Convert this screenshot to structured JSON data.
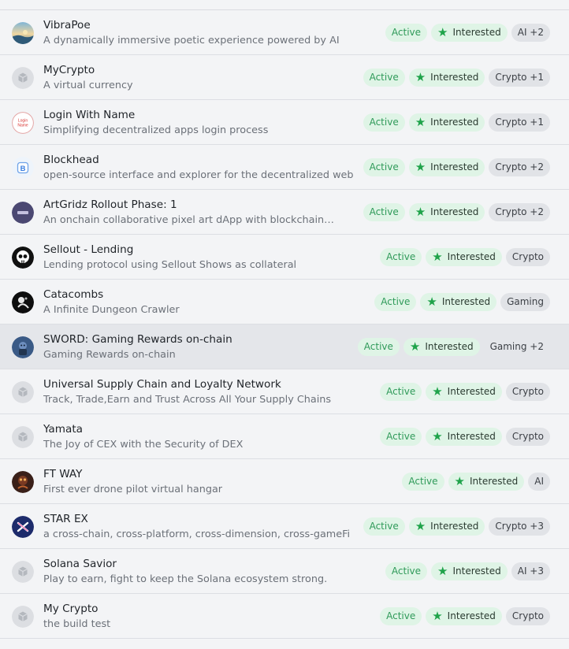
{
  "colors": {
    "active_bg": "#dff4e6",
    "active_text": "#2f9a59",
    "star": "#1fa34a",
    "category_bg": "#e1e3e7"
  },
  "rows": [
    {
      "name": "VibraPoe",
      "description": "A dynamically immersive poetic experience powered by AI",
      "status": "Active",
      "interest": "Interested",
      "category": "AI +2",
      "avatar_icon": "sunset-landscape-avatar-icon"
    },
    {
      "name": "MyCrypto",
      "description": "A virtual currency",
      "status": "Active",
      "interest": "Interested",
      "category": "Crypto +1",
      "avatar_icon": "placeholder-cube-icon"
    },
    {
      "name": "Login With Name",
      "description": "Simplifying decentralized apps login process",
      "status": "Active",
      "interest": "Interested",
      "category": "Crypto +1",
      "avatar_icon": "login-name-logo-icon",
      "avatar_text": "Login Name"
    },
    {
      "name": "Blockhead",
      "description": "open-source interface and explorer for the decentralized web",
      "status": "Active",
      "interest": "Interested",
      "category": "Crypto +2",
      "avatar_icon": "blockhead-b-logo-icon",
      "avatar_text": "B"
    },
    {
      "name": "ArtGridz Rollout Phase: 1",
      "description": "An onchain collaborative pixel art dApp with blockchain…",
      "status": "Active",
      "interest": "Interested",
      "category": "Crypto +2",
      "avatar_icon": "artgridz-logo-icon"
    },
    {
      "name": "Sellout - Lending",
      "description": "Lending protocol using Sellout Shows as collateral",
      "status": "Active",
      "interest": "Interested",
      "category": "Crypto",
      "avatar_icon": "skull-logo-icon"
    },
    {
      "name": "Catacombs",
      "description": "A Infinite Dungeon Crawler",
      "status": "Active",
      "interest": "Interested",
      "category": "Gaming",
      "avatar_icon": "catacombs-logo-icon"
    },
    {
      "name": "SWORD: Gaming Rewards on-chain",
      "description": "Gaming Rewards on-chain",
      "status": "Active",
      "interest": "Interested",
      "category": "Gaming +2",
      "avatar_icon": "sword-character-avatar-icon",
      "highlighted": true
    },
    {
      "name": "Universal Supply Chain and Loyalty Network",
      "description": "Track, Trade,Earn and Trust Across All Your Supply Chains",
      "status": "Active",
      "interest": "Interested",
      "category": "Crypto",
      "avatar_icon": "placeholder-cube-icon"
    },
    {
      "name": "Yamata",
      "description": "The Joy of CEX with the Security of DEX",
      "status": "Active",
      "interest": "Interested",
      "category": "Crypto",
      "avatar_icon": "placeholder-cube-icon"
    },
    {
      "name": "FT WAY",
      "description": "First ever drone pilot virtual hangar",
      "status": "Active",
      "interest": "Interested",
      "category": "AI",
      "avatar_icon": "ft-way-photo-avatar-icon"
    },
    {
      "name": "STAR EX",
      "description": "a cross-chain, cross-platform, cross-dimension, cross-gameFi",
      "status": "Active",
      "interest": "Interested",
      "category": "Crypto +3",
      "avatar_icon": "star-ex-logo-icon"
    },
    {
      "name": "Solana Savior",
      "description": "Play to earn, fight to keep the Solana ecosystem strong.",
      "status": "Active",
      "interest": "Interested",
      "category": "AI +3",
      "avatar_icon": "placeholder-cube-icon"
    },
    {
      "name": "My Crypto",
      "description": "the build test",
      "status": "Active",
      "interest": "Interested",
      "category": "Crypto",
      "avatar_icon": "placeholder-cube-icon"
    }
  ]
}
